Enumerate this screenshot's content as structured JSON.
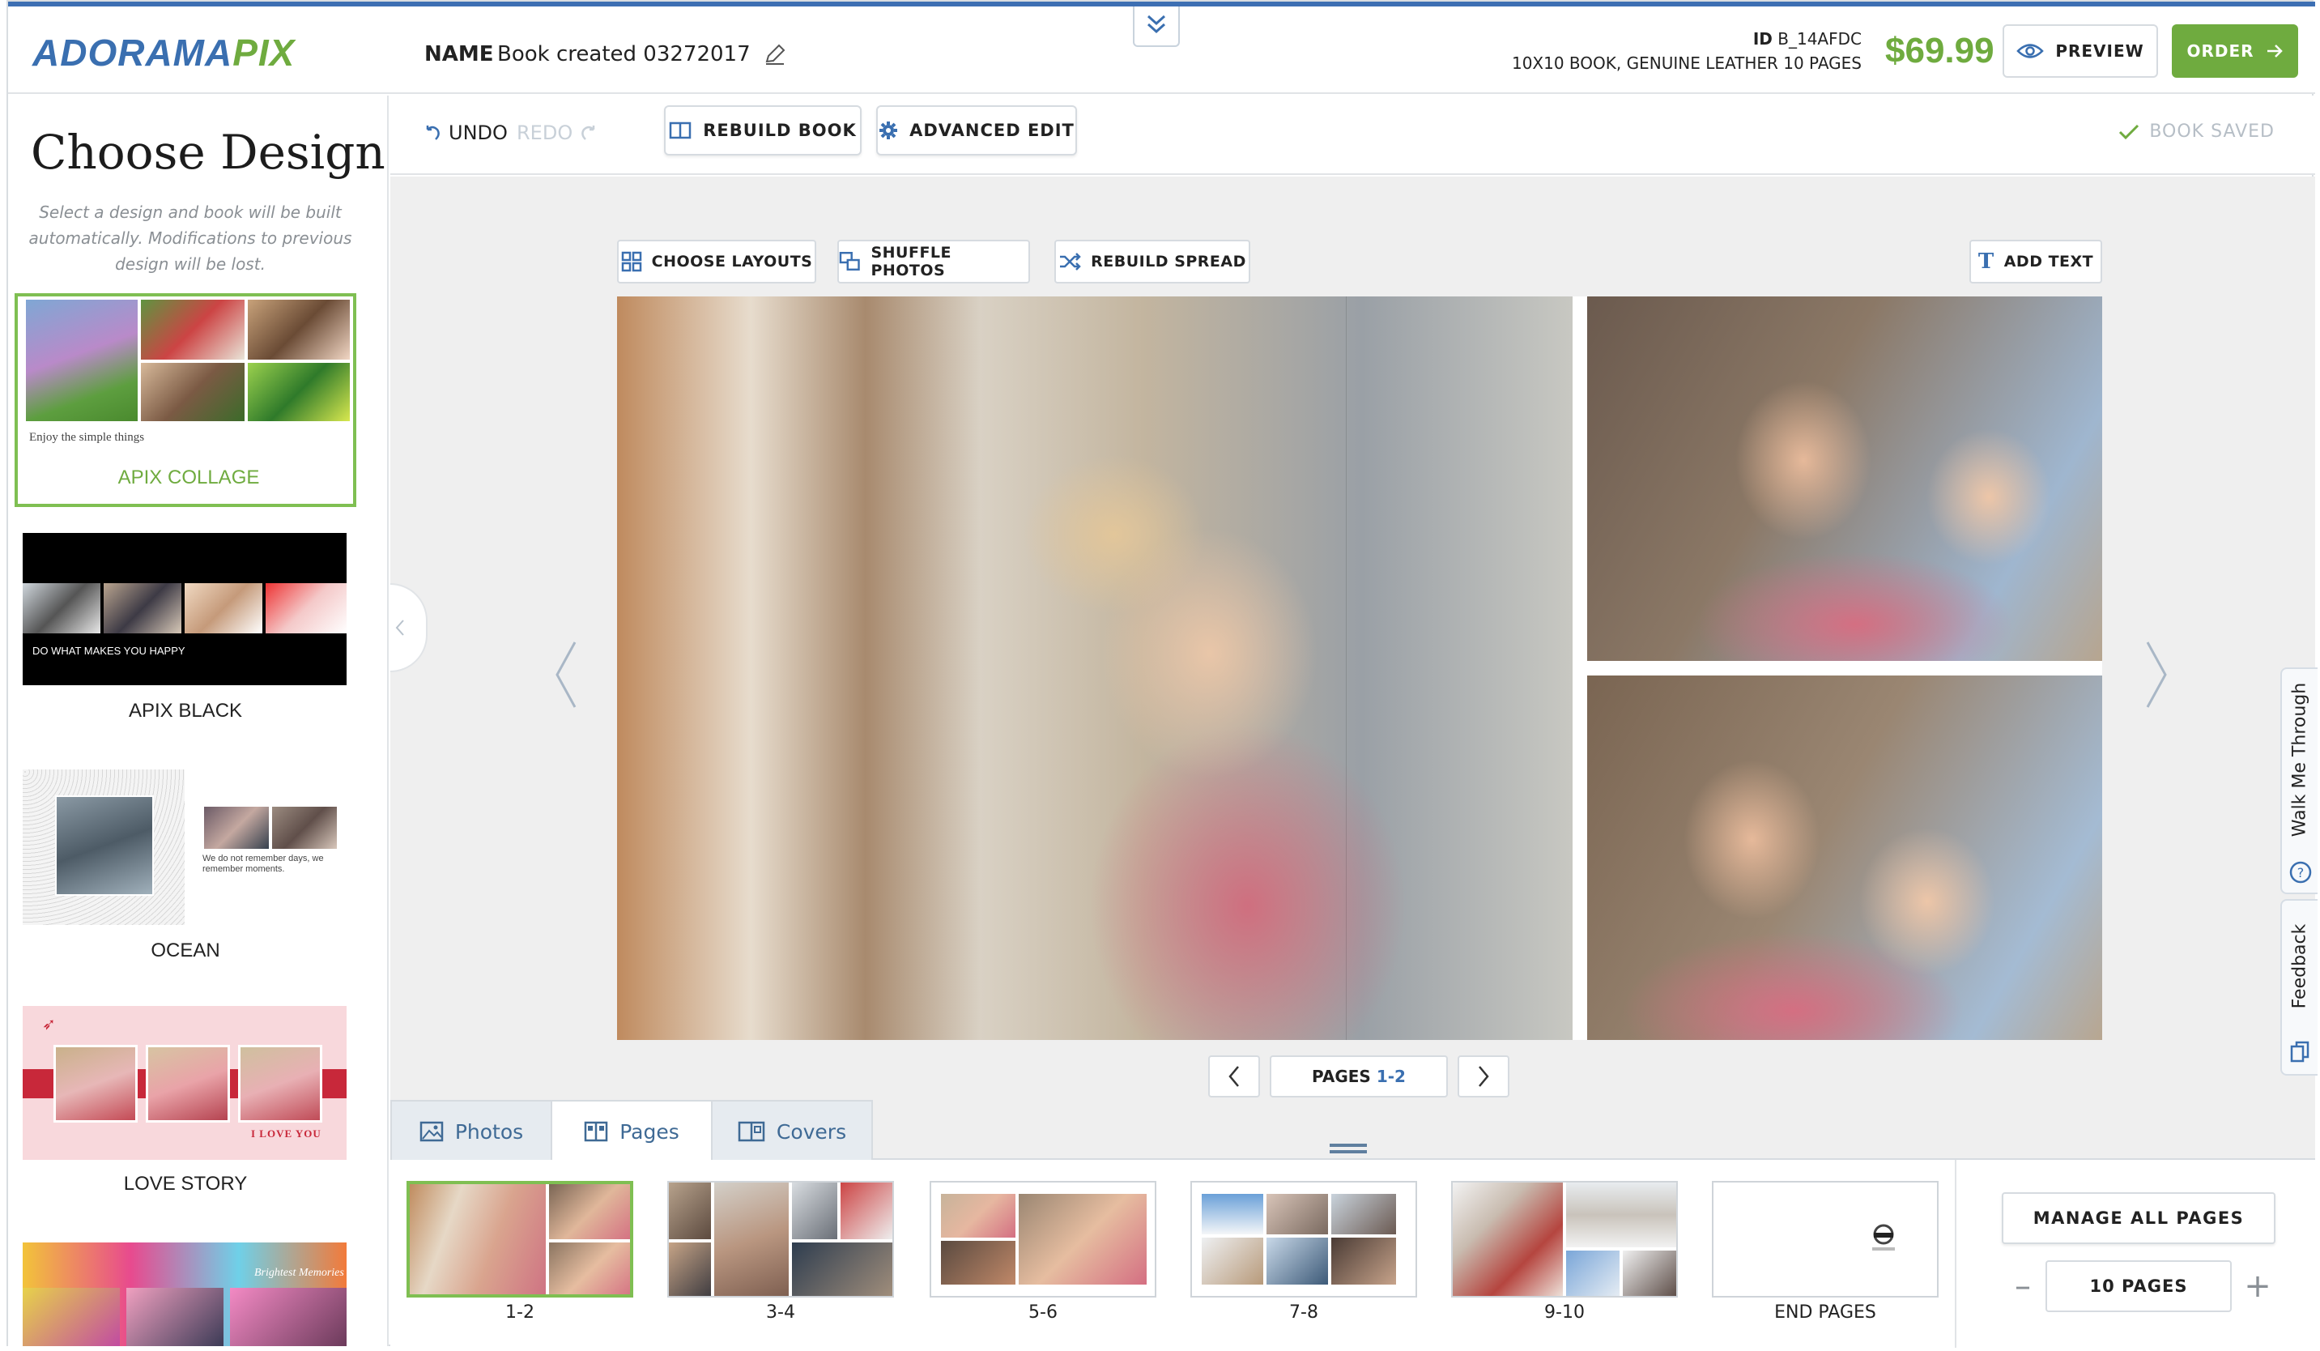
{
  "header": {
    "logo_part1": "ADORAMA",
    "logo_part2": "PIX",
    "name_label": "NAME",
    "book_name": "Book created 03272017",
    "id_label": "ID",
    "id_value": "B_14AFDC",
    "spec": "10X10 BOOK, GENUINE LEATHER 10 PAGES",
    "price": "$69.99",
    "preview_label": "PREVIEW",
    "order_label": "ORDER"
  },
  "sidebar": {
    "title": "Choose Design",
    "description": "Select a design and book will be built automatically. Modifications to previous design will be lost.",
    "designs": [
      {
        "label": "APIX COLLAGE",
        "caption": "Enjoy the simple things",
        "selected": true
      },
      {
        "label": "APIX BLACK",
        "caption": "DO WHAT MAKES YOU HAPPY",
        "selected": false
      },
      {
        "label": "OCEAN",
        "caption": "We do not remember days, we remember moments.",
        "selected": false
      },
      {
        "label": "LOVE STORY",
        "caption": "I LOVE YOU",
        "selected": false
      },
      {
        "label": "",
        "caption": "Brightest Memories",
        "selected": false
      }
    ]
  },
  "toolbar": {
    "undo_label": "UNDO",
    "redo_label": "REDO",
    "rebuild_book_label": "REBUILD BOOK",
    "advanced_edit_label": "ADVANCED EDIT",
    "book_saved_label": "BOOK SAVED"
  },
  "canvas": {
    "choose_layouts_label": "CHOOSE LAYOUTS",
    "shuffle_photos_label": "SHUFFLE PHOTOS",
    "rebuild_spread_label": "REBUILD SPREAD",
    "add_text_label": "ADD TEXT",
    "pages_label": "PAGES",
    "pages_value": "1-2"
  },
  "side_tabs": {
    "walk_label": "Walk Me Through",
    "feedback_label": "Feedback"
  },
  "bottom": {
    "tabs": [
      {
        "label": "Photos",
        "icon": "image-icon"
      },
      {
        "label": "Pages",
        "icon": "pages-icon"
      },
      {
        "label": "Covers",
        "icon": "covers-icon"
      }
    ],
    "active_tab": "Pages",
    "page_thumbs": [
      {
        "label": "1-2"
      },
      {
        "label": "3-4"
      },
      {
        "label": "5-6"
      },
      {
        "label": "7-8"
      },
      {
        "label": "9-10"
      },
      {
        "label": "END PAGES"
      }
    ],
    "manage_all_label": "MANAGE ALL PAGES",
    "pages_count": "10 PAGES"
  },
  "colors": {
    "brand_blue": "#3a6fb0",
    "brand_green": "#6fab3f",
    "tab_text": "#3f6a95"
  }
}
